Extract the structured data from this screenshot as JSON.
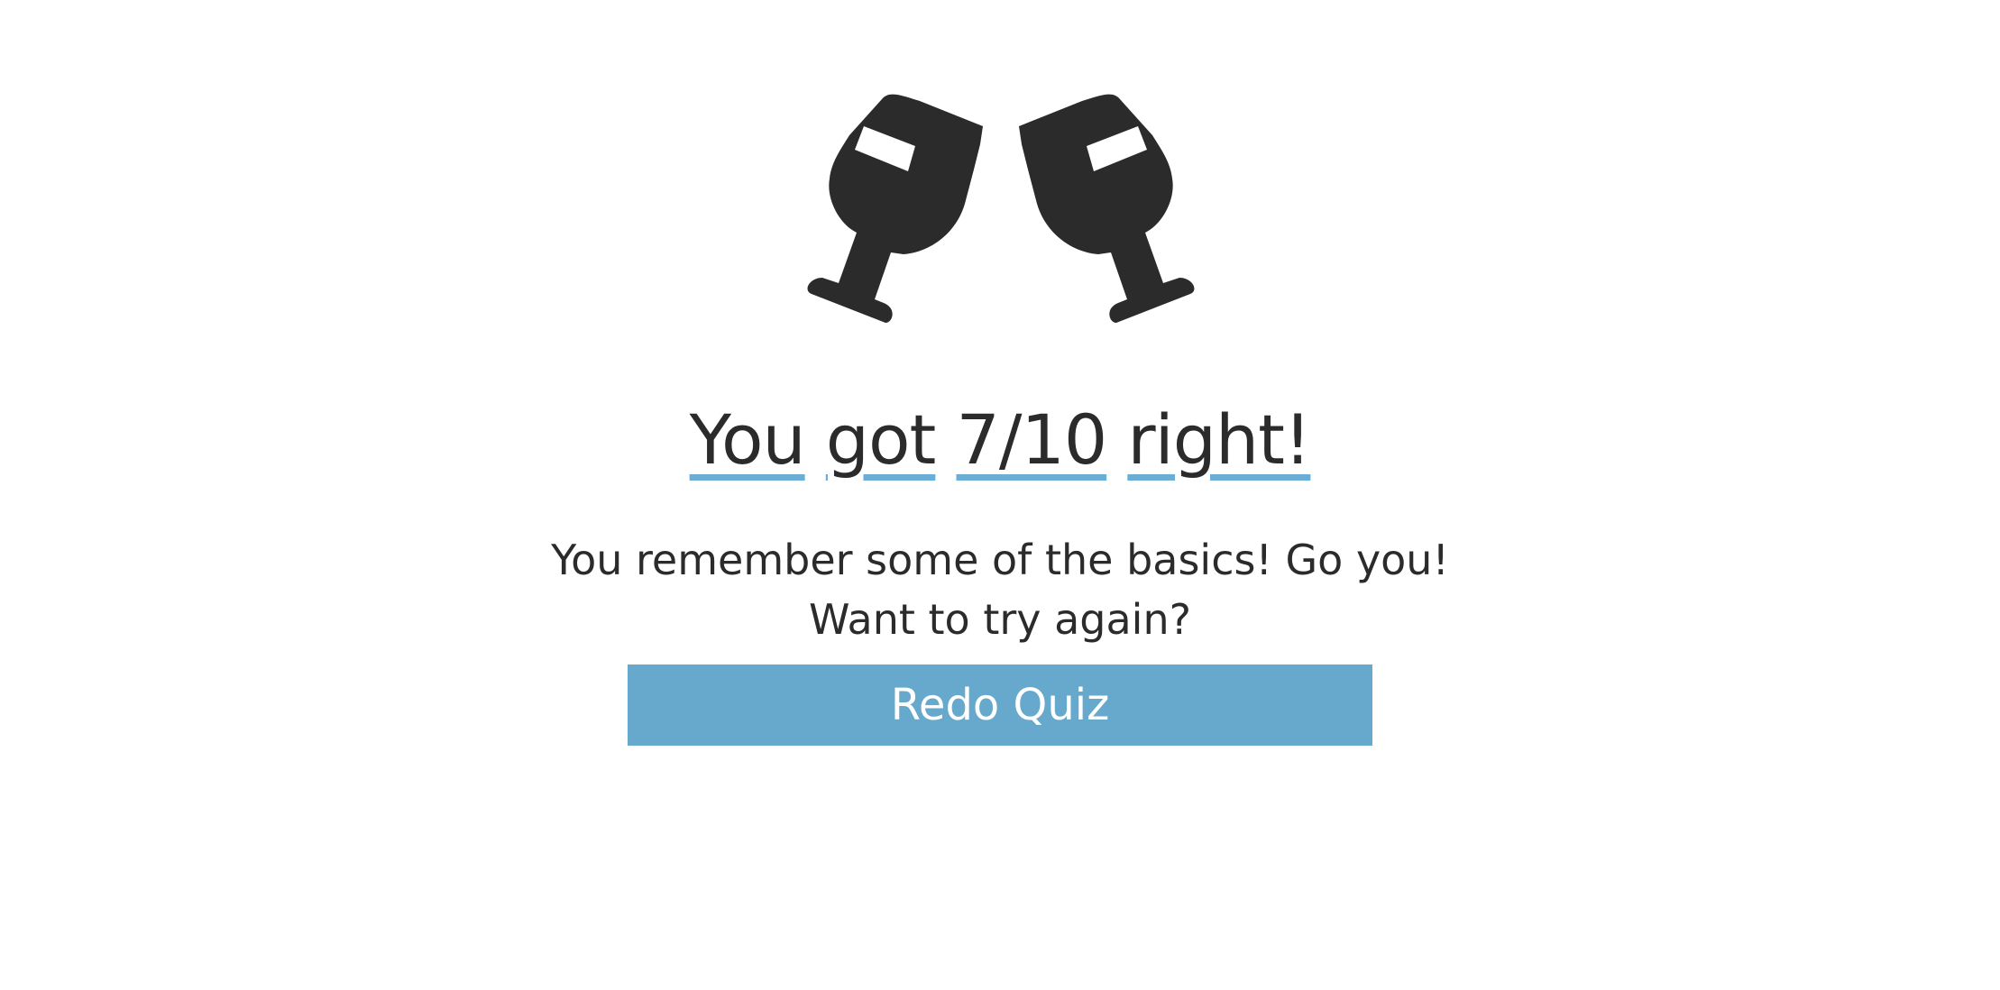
{
  "result": {
    "icon": "cheers-wine-glasses-icon",
    "title_words": [
      "You",
      "got",
      "7/10",
      "right!"
    ],
    "score": "7/10",
    "message_line1": "You remember some of the basics! Go you!",
    "message_line2": "Want to try again?",
    "redo_label": "Redo Quiz"
  },
  "colors": {
    "text": "#2b2b2b",
    "accent_underline": "#6aaed6",
    "button_bg": "#66a9cc",
    "button_text": "#ffffff",
    "background": "#ffffff"
  }
}
